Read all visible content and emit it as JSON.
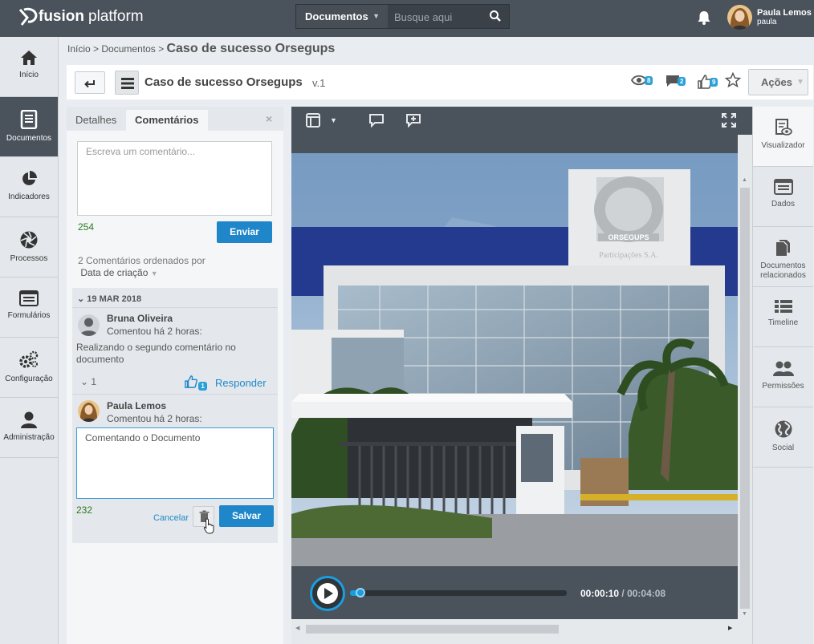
{
  "app": {
    "brand_bold": "fusion",
    "brand_rest": "platform"
  },
  "search": {
    "scope": "Documentos",
    "placeholder": "Busque aqui"
  },
  "user": {
    "name": "Paula Lemos",
    "login": "paula"
  },
  "sidebar": {
    "items": [
      {
        "label": "Início",
        "icon": "home-icon"
      },
      {
        "label": "Documentos",
        "icon": "document-icon",
        "active": true
      },
      {
        "label": "Indicadores",
        "icon": "pie-chart-icon"
      },
      {
        "label": "Processos",
        "icon": "aperture-icon"
      },
      {
        "label": "Formulários",
        "icon": "form-icon"
      },
      {
        "label": "Configuração",
        "icon": "gears-icon"
      },
      {
        "label": "Administração",
        "icon": "user-icon"
      }
    ]
  },
  "breadcrumb": {
    "home": "Início",
    "sep1": ">",
    "section": "Documentos",
    "sep2": ">",
    "current": "Caso de sucesso Orsegups"
  },
  "document": {
    "title": "Caso de sucesso Orsegups",
    "version": "v.1",
    "views": "8",
    "comments": "2",
    "likes": "9",
    "actions_label": "Ações"
  },
  "panel": {
    "tab_details": "Detalhes",
    "tab_comments": "Comentários",
    "close": "×",
    "new_comment_placeholder": "Escreva um comentário...",
    "new_comment_remaining": "254",
    "send_label": "Enviar",
    "sort_text": "2  Comentários ordenados por",
    "sort_value": "Data de criação"
  },
  "thread": {
    "date": "19 MAR 2018",
    "comments": [
      {
        "author": "Bruna Oliveira",
        "time": "Comentou há 2 horas:",
        "text": "Realizando o segundo comentário no documento",
        "replies": "1",
        "likes": "1",
        "reply_label": "Responder"
      },
      {
        "author": "Paula Lemos",
        "time": "Comentou há 2 horas:",
        "edit_text": "Comentando o Documento",
        "remaining": "232",
        "cancel_label": "Cancelar",
        "save_label": "Salvar"
      }
    ]
  },
  "video": {
    "current_time": "00:00:10",
    "separator": " / ",
    "total_time": "00:04:08",
    "progress": 0.04
  },
  "photo": {
    "sign_top": "ORSEGUPS",
    "sign_bottom": "Participações S.A."
  },
  "rightpanel": {
    "items": [
      {
        "label": "Visualizador",
        "icon": "viewer-icon",
        "active": true
      },
      {
        "label": "Dados",
        "icon": "data-icon"
      },
      {
        "label": "Documentos relacionados",
        "icon": "related-docs-icon"
      },
      {
        "label": "Timeline",
        "icon": "timeline-icon"
      },
      {
        "label": "Permissões",
        "icon": "permissions-icon"
      },
      {
        "label": "Social",
        "icon": "globe-icon"
      }
    ]
  }
}
